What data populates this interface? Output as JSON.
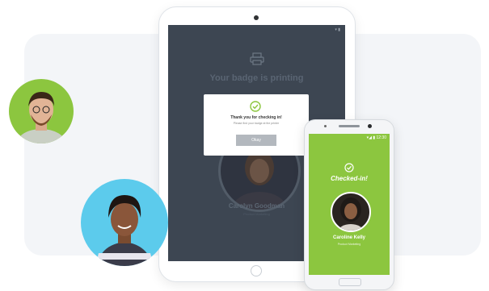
{
  "tablet": {
    "title": "Your badge is printing",
    "attendee_name": "Carolyn Goodman",
    "attendee_subtitle": "Product Marketing",
    "dialog": {
      "title": "Thank you for checking in!",
      "subtitle": "Please find your badge at the printer",
      "button_label": "Okay"
    }
  },
  "phone": {
    "status": "▾◢ ▮ 12:30",
    "checked_label": "Checked-in!",
    "attendee_name": "Caroline Kelly",
    "attendee_subtitle": "Product Marketing"
  },
  "colors": {
    "accent_green": "#8cc63f",
    "tablet_screen": "#3d4652",
    "avatar_blue": "#5ccbec"
  },
  "icons": [
    "printer-icon",
    "check-circle-icon"
  ]
}
